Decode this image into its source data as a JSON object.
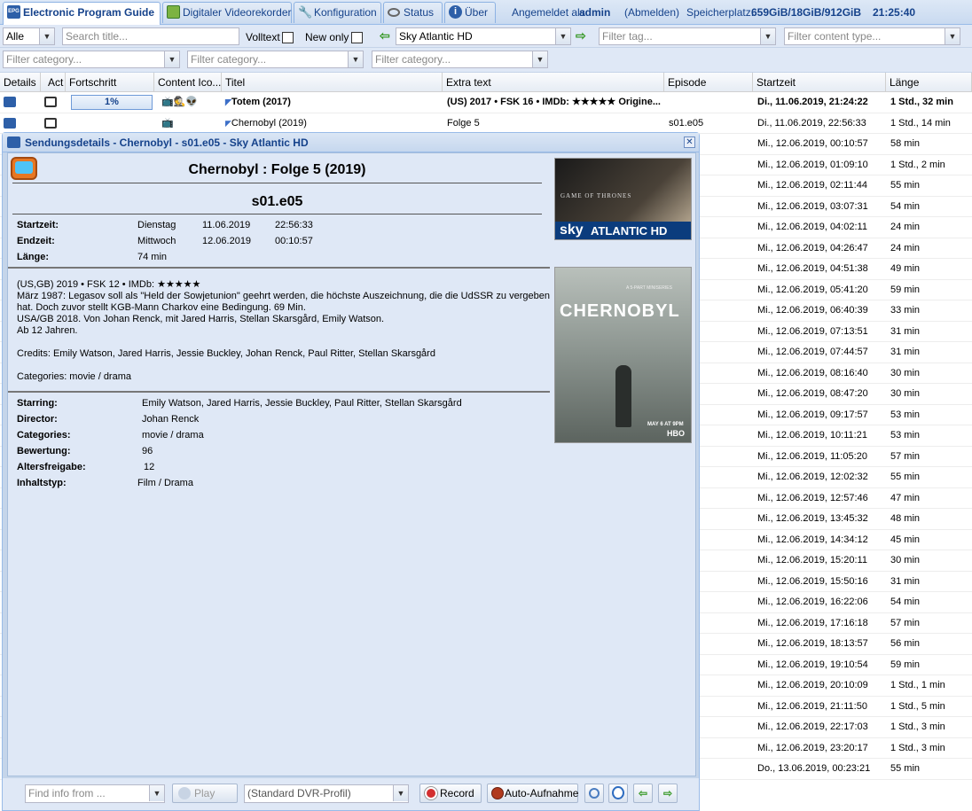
{
  "tabs": [
    {
      "label": "Electronic Program Guide",
      "icon": "epg-icon"
    },
    {
      "label": "Digitaler Videorekorder",
      "icon": "download-icon"
    },
    {
      "label": "Konfiguration",
      "icon": "wrench-icon"
    },
    {
      "label": "Status",
      "icon": "eye-icon"
    },
    {
      "label": "Über",
      "icon": "info-icon"
    }
  ],
  "header": {
    "logged_in": "Angemeldet als",
    "user": "admin",
    "logout": "(Abmelden)",
    "storage_label": "Speicherplatz:",
    "storage_value": "659GiB/18GiB/912GiB",
    "time": "21:25:40"
  },
  "toolbar1": {
    "mode": "Alle",
    "title_placeholder": "Search title...",
    "volltext": "Volltext",
    "new_only": "New only",
    "channel": "Sky Atlantic HD",
    "tag_placeholder": "Filter tag...",
    "content_type_placeholder": "Filter content type..."
  },
  "toolbar2": {
    "cat1": "Filter category...",
    "cat2": "Filter category...",
    "cat3": "Filter category..."
  },
  "columns": [
    "Details",
    "Act",
    "Fortschritt",
    "Content Ico...",
    "Titel",
    "Extra text",
    "Episode",
    "Startzeit",
    "Länge"
  ],
  "rows": [
    {
      "progress": "1%",
      "title": "Totem (2017)",
      "extra": "(US) 2017 • FSK 16 • IMDb: ★★★★★ Origine...",
      "episode": "",
      "start": "Di., 11.06.2019, 21:24:22",
      "length": "1 Std., 32 min",
      "bold": true
    },
    {
      "progress": "",
      "title": "Chernobyl (2019)",
      "extra": "Folge 5",
      "episode": "s01.e05",
      "start": "Di., 11.06.2019, 22:56:33",
      "length": "1 Std., 14 min",
      "bold": false
    }
  ],
  "hidden_rows": [
    {
      "start": "Mi., 12.06.2019, 00:10:57",
      "length": "58 min"
    },
    {
      "start": "Mi., 12.06.2019, 01:09:10",
      "length": "1 Std., 2 min"
    },
    {
      "start": "Mi., 12.06.2019, 02:11:44",
      "length": "55 min"
    },
    {
      "start": "Mi., 12.06.2019, 03:07:31",
      "length": "54 min"
    },
    {
      "start": "Mi., 12.06.2019, 04:02:11",
      "length": "24 min"
    },
    {
      "start": "Mi., 12.06.2019, 04:26:47",
      "length": "24 min"
    },
    {
      "start": "Mi., 12.06.2019, 04:51:38",
      "length": "49 min"
    },
    {
      "start": "Mi., 12.06.2019, 05:41:20",
      "length": "59 min"
    },
    {
      "start": "Mi., 12.06.2019, 06:40:39",
      "length": "33 min"
    },
    {
      "start": "Mi., 12.06.2019, 07:13:51",
      "length": "31 min"
    },
    {
      "start": "Mi., 12.06.2019, 07:44:57",
      "length": "31 min"
    },
    {
      "start": "Mi., 12.06.2019, 08:16:40",
      "length": "30 min"
    },
    {
      "start": "Mi., 12.06.2019, 08:47:20",
      "length": "30 min"
    },
    {
      "start": "Mi., 12.06.2019, 09:17:57",
      "length": "53 min"
    },
    {
      "start": "Mi., 12.06.2019, 10:11:21",
      "length": "53 min"
    },
    {
      "start": "Mi., 12.06.2019, 11:05:20",
      "length": "57 min"
    },
    {
      "start": "Mi., 12.06.2019, 12:02:32",
      "length": "55 min"
    },
    {
      "start": "Mi., 12.06.2019, 12:57:46",
      "length": "47 min"
    },
    {
      "start": "Mi., 12.06.2019, 13:45:32",
      "length": "48 min"
    },
    {
      "start": "Mi., 12.06.2019, 14:34:12",
      "length": "45 min"
    },
    {
      "start": "Mi., 12.06.2019, 15:20:11",
      "length": "30 min"
    },
    {
      "start": "Mi., 12.06.2019, 15:50:16",
      "length": "31 min"
    },
    {
      "start": "Mi., 12.06.2019, 16:22:06",
      "length": "54 min"
    },
    {
      "start": "Mi., 12.06.2019, 17:16:18",
      "length": "57 min"
    },
    {
      "start": "Mi., 12.06.2019, 18:13:57",
      "length": "56 min"
    },
    {
      "start": "Mi., 12.06.2019, 19:10:54",
      "length": "59 min"
    },
    {
      "start": "Mi., 12.06.2019, 20:10:09",
      "length": "1 Std., 1 min"
    },
    {
      "start": "Mi., 12.06.2019, 21:11:50",
      "length": "1 Std., 5 min"
    },
    {
      "start": "Mi., 12.06.2019, 22:17:03",
      "length": "1 Std., 3 min"
    },
    {
      "start": "Mi., 12.06.2019, 23:20:17",
      "length": "1 Std., 3 min"
    },
    {
      "start": "Do., 13.06.2019, 00:23:21",
      "length": "55 min"
    }
  ],
  "dialog": {
    "title": "Sendungsdetails - Chernobyl - s01.e05 - Sky Atlantic HD",
    "heading": "Chernobyl : Folge 5 (2019)",
    "episode": "s01.e05",
    "start_label": "Startzeit:",
    "start_day": "Dienstag",
    "start_date": "11.06.2019",
    "start_time": "22:56:33",
    "end_label": "Endzeit:",
    "end_day": "Mittwoch",
    "end_date": "12.06.2019",
    "end_time": "00:10:57",
    "length_label": "Länge:",
    "length_value": "74 min",
    "desc_line1": "(US,GB) 2019 • FSK 12 • IMDb: ★★★★★",
    "desc_line2": "März 1987: Legasov soll als \"Held der Sowjetunion\" geehrt werden, die höchste Auszeichnung, die die UdSSR zu vergeben",
    "desc_line3": "hat. Doch zuvor stellt KGB-Mann Charkov eine Bedingung. 69 Min.",
    "desc_line4": "USA/GB 2018. Von Johan Renck, mit Jared Harris, Stellan Skarsgård, Emily Watson.",
    "desc_line5": "Ab 12 Jahren.",
    "credits": "Credits: Emily Watson, Jared Harris, Jessie Buckley, Johan Renck, Paul Ritter, Stellan Skarsgård",
    "categories_line": "Categories: movie / drama",
    "starring_label": "Starring:",
    "starring": "Emily Watson, Jared Harris, Jessie Buckley, Paul Ritter, Stellan Skarsgård",
    "director_label": "Director:",
    "director": "Johan Renck",
    "categories_label": "Categories:",
    "categories": "movie / drama",
    "rating_label": "Bewertung:",
    "rating": "96",
    "age_label": "Altersfreigabe:",
    "age": "12",
    "content_label": "Inhaltstyp:",
    "content": "Film / Drama",
    "channel_logo_text1": "sky",
    "channel_logo_text2": "ATLANTIC HD",
    "channel_logo_show": "GAME OF THRONES",
    "poster_title": "CHERNOBYL",
    "poster_sub": "A 5-PART MINISERIES",
    "poster_date": "MAY 6 AT 9PM",
    "poster_brand": "HBO"
  },
  "footer": {
    "find_placeholder": "Find info from ...",
    "play": "Play",
    "profile": "(Standard DVR-Profil)",
    "record": "Record",
    "auto": "Auto-Aufnahme"
  },
  "colors": {
    "accent": "#15428b",
    "panel": "#dfe8f6",
    "border": "#99bbe8"
  }
}
